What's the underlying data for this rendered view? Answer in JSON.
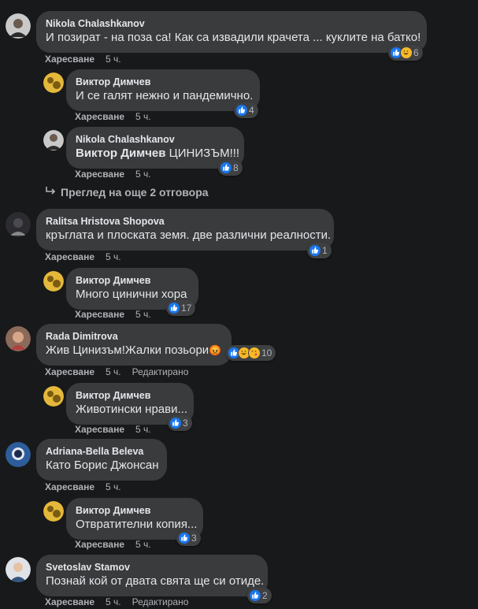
{
  "labels": {
    "like": "Харесване",
    "edited": "Редактирано"
  },
  "comments": [
    {
      "author": "Nikola Chalashkanov",
      "text": "И позират - на поза са! Как са извадили крачета ... куклите на батко!",
      "time": "5 ч.",
      "reactions": 6
    },
    {
      "author": "Виктор Димчев",
      "text": "И се галят нежно и пандемично.",
      "time": "5 ч.",
      "reactions": 4
    },
    {
      "author": "Nikola Chalashkanov",
      "mention": "Виктор Димчев",
      "text": "ЦИНИЗЪМ!!!",
      "time": "5 ч.",
      "reactions": 8
    },
    {
      "author": "Ralitsa Hristova Shopova",
      "text": "кръглата и плоската земя. две различни реалности.",
      "time": "5 ч.",
      "reactions": 1
    },
    {
      "author": "Виктор Димчев",
      "text": "Много цинични хора",
      "time": "5 ч.",
      "reactions": 17
    },
    {
      "author": "Rada Dimitrova",
      "text": "Жив Цинизъм!Жалки позьори",
      "emoji": "😡",
      "time": "5 ч.",
      "edited": true,
      "reactions": 10
    },
    {
      "author": "Виктор Димчев",
      "text": "Животински нрави...",
      "time": "5 ч.",
      "reactions": 3
    },
    {
      "author": "Adriana-Bella Beleva",
      "text": "Като Борис Джонсан",
      "time": "5 ч."
    },
    {
      "author": "Виктор Димчев",
      "text": "Отвратителни копия...",
      "time": "5 ч.",
      "reactions": 3
    },
    {
      "author": "Svetoslav Stamov",
      "text": "Познай кой от двата свята ще си отиде.",
      "time": "5 ч.",
      "edited": true,
      "reactions": 2
    }
  ],
  "view_more": "Преглед на още 2 отговора",
  "colors": {
    "bg": "#18191a",
    "bubble": "#3a3b3c",
    "like_blue": "#1877f2",
    "haha_yellow": "#f7b928"
  },
  "icons": [
    "like-reaction-icon",
    "haha-reaction-icon",
    "reply-arrow-icon"
  ]
}
